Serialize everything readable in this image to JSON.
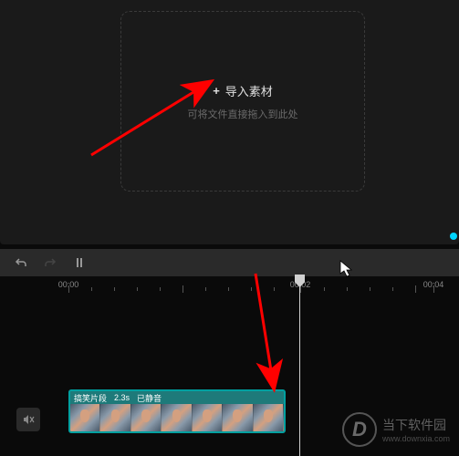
{
  "import": {
    "button_label": "导入素材",
    "hint_text": "可将文件直接拖入到此处"
  },
  "toolbar": {
    "undo_icon": "undo",
    "redo_icon": "redo",
    "split_icon": "split"
  },
  "ruler": {
    "ticks": [
      {
        "label": "00:00",
        "pos": 0
      },
      {
        "label": "00:02",
        "pos": 254
      },
      {
        "label": "00:04",
        "pos": 400
      }
    ]
  },
  "clip": {
    "name": "搞笑片段",
    "duration": "2.3s",
    "status": "已静音"
  },
  "watermark": {
    "logo_char": "D",
    "name": "当下软件园",
    "url": "www.downxia.com"
  }
}
